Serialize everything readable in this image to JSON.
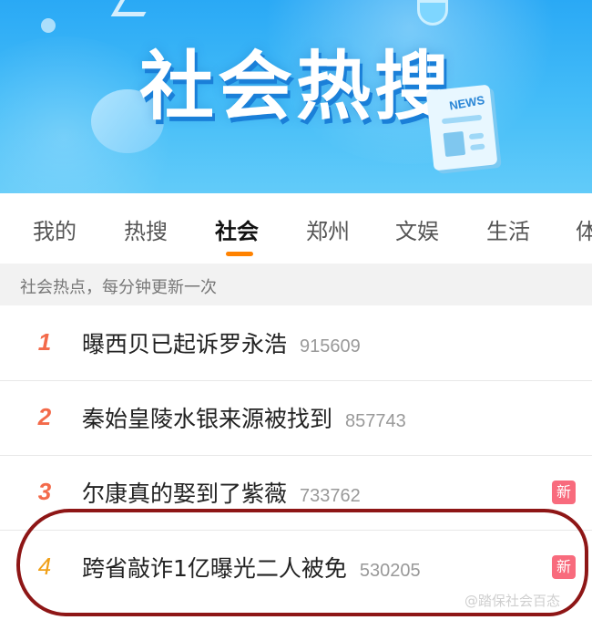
{
  "banner": {
    "title": "社会热搜",
    "news_label": "NEWS"
  },
  "tabs": [
    {
      "label": "我的",
      "active": false
    },
    {
      "label": "热搜",
      "active": false
    },
    {
      "label": "社会",
      "active": true
    },
    {
      "label": "郑州",
      "active": false
    },
    {
      "label": "文娱",
      "active": false
    },
    {
      "label": "生活",
      "active": false
    },
    {
      "label": "体",
      "active": false
    }
  ],
  "subtitle": "社会热点，每分钟更新一次",
  "list": [
    {
      "rank": "1",
      "topic": "曝西贝已起诉罗永浩",
      "count": "915609",
      "badge": ""
    },
    {
      "rank": "2",
      "topic": "秦始皇陵水银来源被找到",
      "count": "857743",
      "badge": ""
    },
    {
      "rank": "3",
      "topic": "尔康真的娶到了紫薇",
      "count": "733762",
      "badge": "新"
    },
    {
      "rank": "4",
      "topic": "跨省敲诈1亿曝光二人被免",
      "count": "530205",
      "badge": "新"
    }
  ],
  "watermark": "@踏保社会百态",
  "colors": {
    "banner": "#2aa9f5",
    "accent_underline": "#ff8200",
    "rank_top": "#f36a4a",
    "rank_other": "#f0a019",
    "badge_new": "#f86b7d",
    "highlight_oval": "#8e1616"
  }
}
